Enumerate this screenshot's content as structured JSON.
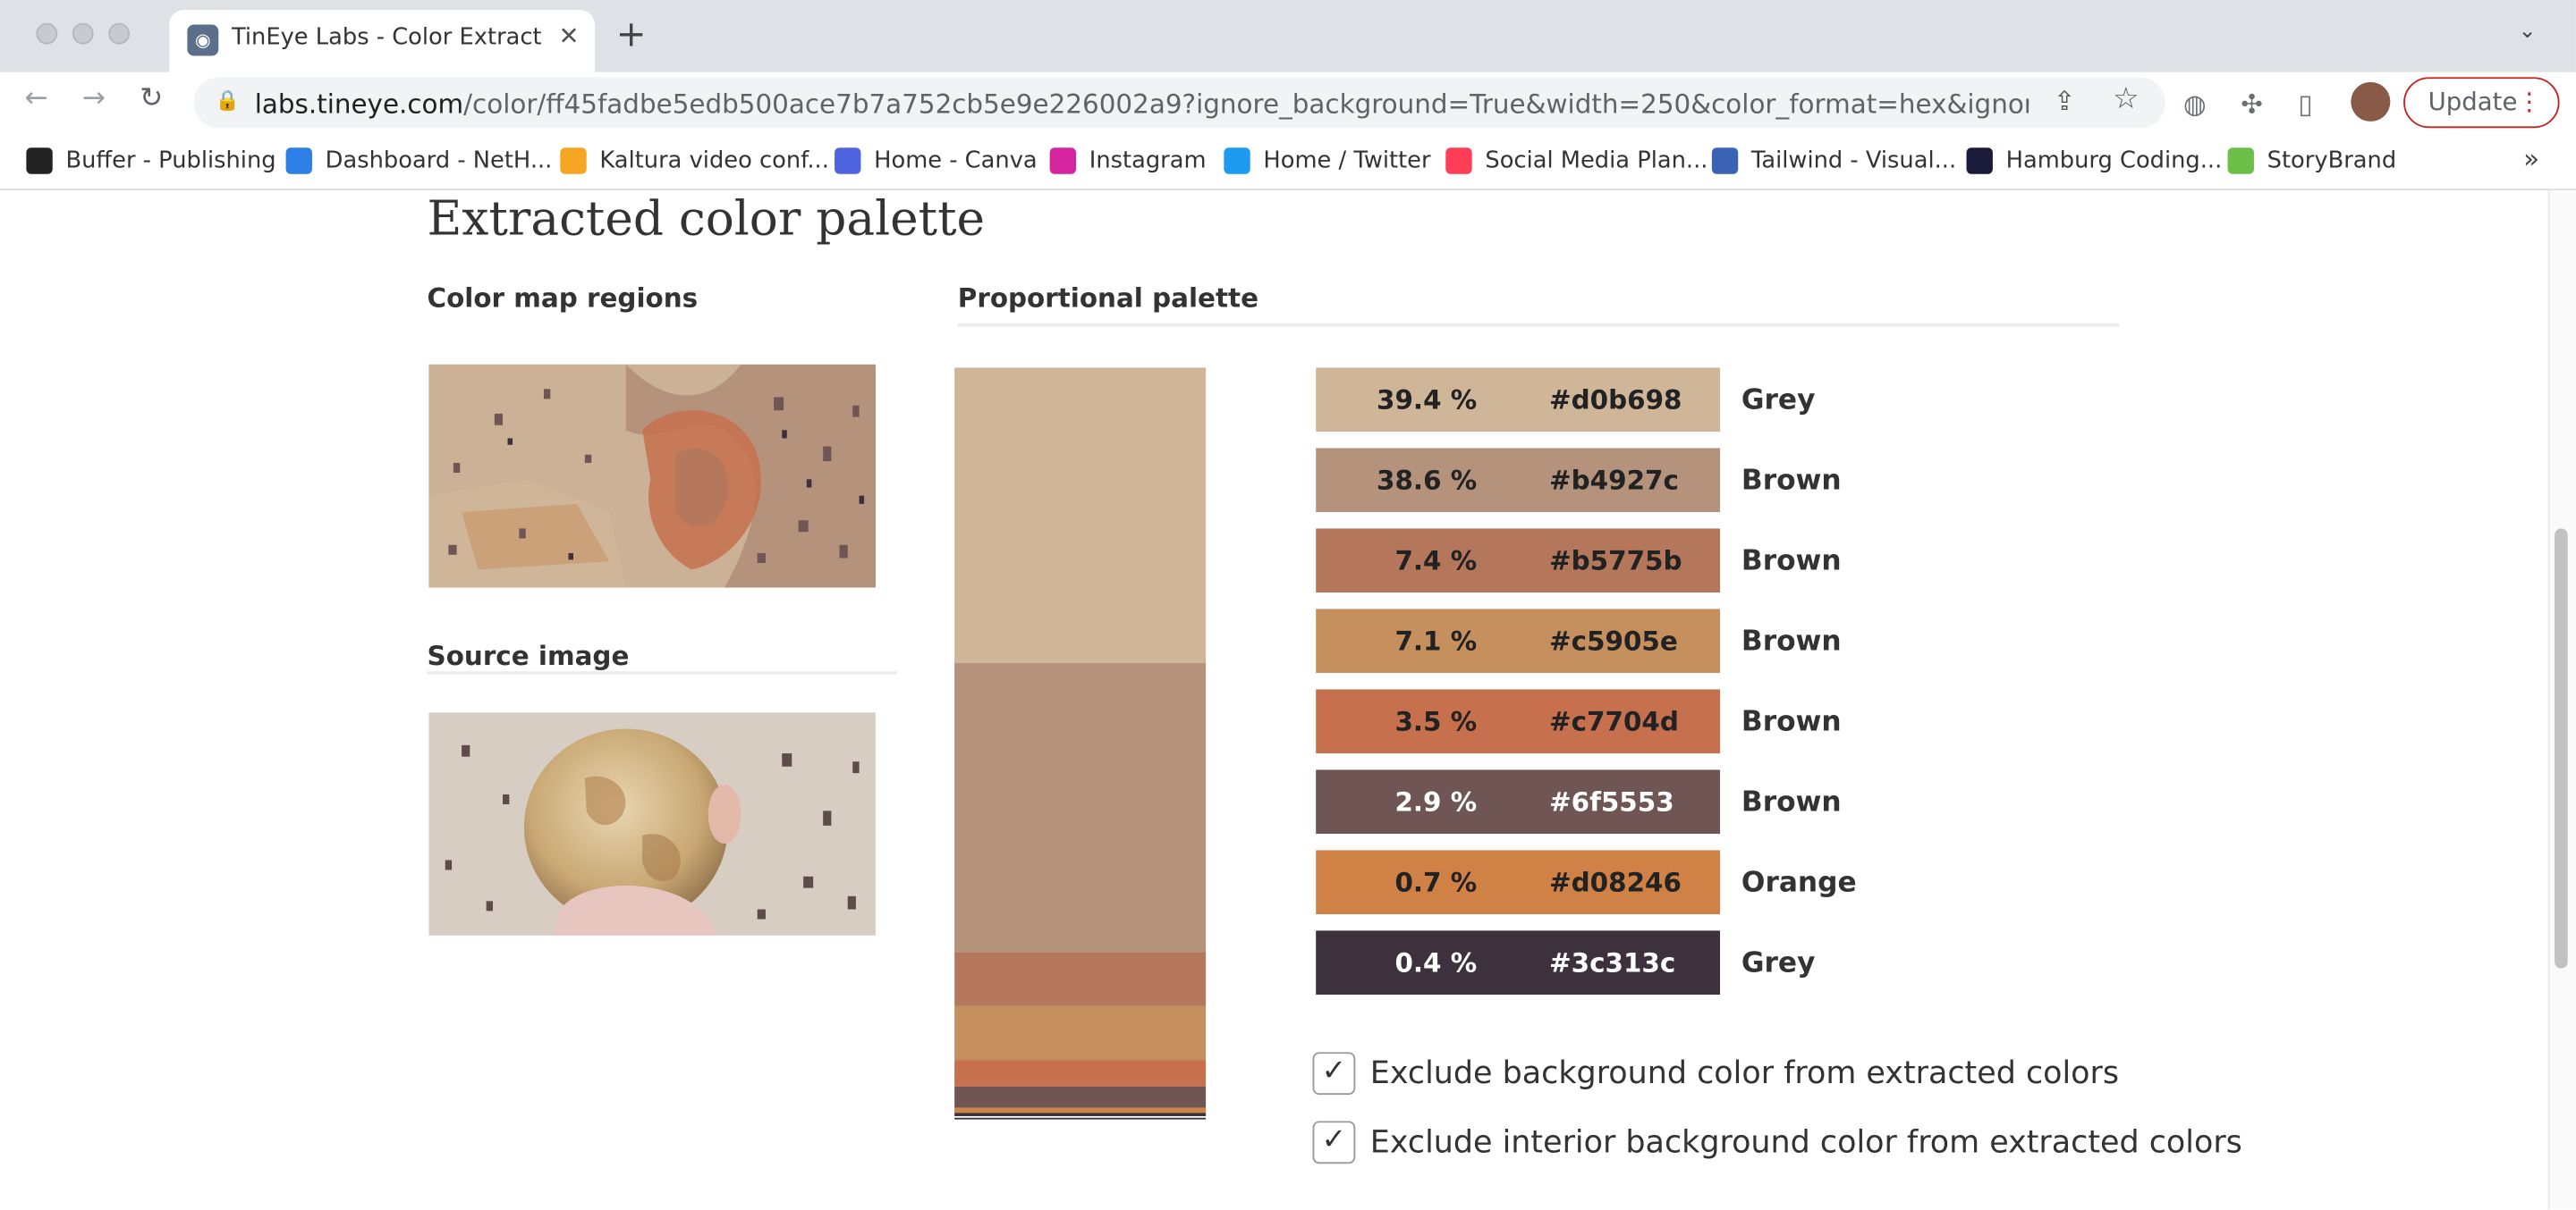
{
  "browser": {
    "tab_title": "TinEye Labs - Color Extraction",
    "new_tab": "+",
    "url_host": "labs.tineye.com",
    "url_rest": "/color/ff45fadbe5edb500ace7b7a752cb5e9e226002a9?ignore_background=True&width=250&color_format=hex&ignore_interior_ba...",
    "update_label": "Update",
    "bookmarks": [
      {
        "label": "Buffer - Publishing",
        "icon": "buffer-icon",
        "color": "#222222"
      },
      {
        "label": "Dashboard - NetH...",
        "icon": "netlify-icon",
        "color": "#2e80e6"
      },
      {
        "label": "Kaltura video conf...",
        "icon": "kaltura-icon",
        "color": "#f5a623"
      },
      {
        "label": "Home - Canva",
        "icon": "canva-icon",
        "color": "#4f65e0"
      },
      {
        "label": "Instagram",
        "icon": "instagram-icon",
        "color": "#d6249f"
      },
      {
        "label": "Home / Twitter",
        "icon": "twitter-icon",
        "color": "#1d9bf0"
      },
      {
        "label": "Social Media Plan...",
        "icon": "monday-icon",
        "color": "#ff3d57"
      },
      {
        "label": "Tailwind - Visual...",
        "icon": "tailwind-icon",
        "color": "#3a63b5"
      },
      {
        "label": "Hamburg Coding...",
        "icon": "hamburg-coding-icon",
        "color": "#1a1a3a"
      },
      {
        "label": "StoryBrand",
        "icon": "storybrand-icon",
        "color": "#6cc04a"
      }
    ]
  },
  "page": {
    "title": "Extracted color palette",
    "color_map_heading": "Color map regions",
    "source_heading": "Source image",
    "proportional_heading": "Proportional palette"
  },
  "colors": [
    {
      "percent": "39.4 %",
      "hex": "#d0b698",
      "name": "Grey",
      "fraction": 0.394,
      "dark": false
    },
    {
      "percent": "38.6 %",
      "hex": "#b4927c",
      "name": "Brown",
      "fraction": 0.386,
      "dark": false
    },
    {
      "percent": "7.4 %",
      "hex": "#b5775b",
      "name": "Brown",
      "fraction": 0.074,
      "dark": false
    },
    {
      "percent": "7.1 %",
      "hex": "#c5905e",
      "name": "Brown",
      "fraction": 0.071,
      "dark": false
    },
    {
      "percent": "3.5 %",
      "hex": "#c7704d",
      "name": "Brown",
      "fraction": 0.035,
      "dark": false
    },
    {
      "percent": "2.9 %",
      "hex": "#6f5553",
      "name": "Brown",
      "fraction": 0.029,
      "dark": true
    },
    {
      "percent": "0.7 %",
      "hex": "#d08246",
      "name": "Orange",
      "fraction": 0.007,
      "dark": false
    },
    {
      "percent": "0.4 %",
      "hex": "#3c313c",
      "name": "Grey",
      "fraction": 0.004,
      "dark": true
    }
  ],
  "options": {
    "exclude_background": {
      "label": "Exclude background color from extracted colors",
      "checked": true
    },
    "exclude_interior": {
      "label": "Exclude interior background color from extracted colors",
      "checked": true
    }
  }
}
